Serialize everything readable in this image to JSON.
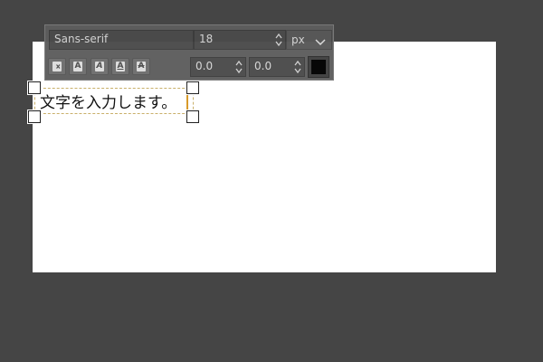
{
  "text_toolbox": {
    "font_name": "Sans-serif",
    "font_size": "18",
    "unit": "px",
    "baseline_offset": "0.0",
    "kerning": "0.0",
    "text_color": "#000000",
    "style_buttons": [
      {
        "name": "clear-style-button",
        "icon": "eraser-icon"
      },
      {
        "name": "bold-button",
        "icon": "bold-icon"
      },
      {
        "name": "italic-button",
        "icon": "italic-icon"
      },
      {
        "name": "underline-button",
        "icon": "underline-icon"
      },
      {
        "name": "strikethrough-button",
        "icon": "strikethrough-icon"
      }
    ]
  },
  "canvas": {
    "background": "#ffffff",
    "text_layer": {
      "content": "文字を入力します。"
    }
  },
  "colors": {
    "workspace": "#454545",
    "caret": "#d89a2a",
    "textbox_border": "#c9b06a"
  }
}
